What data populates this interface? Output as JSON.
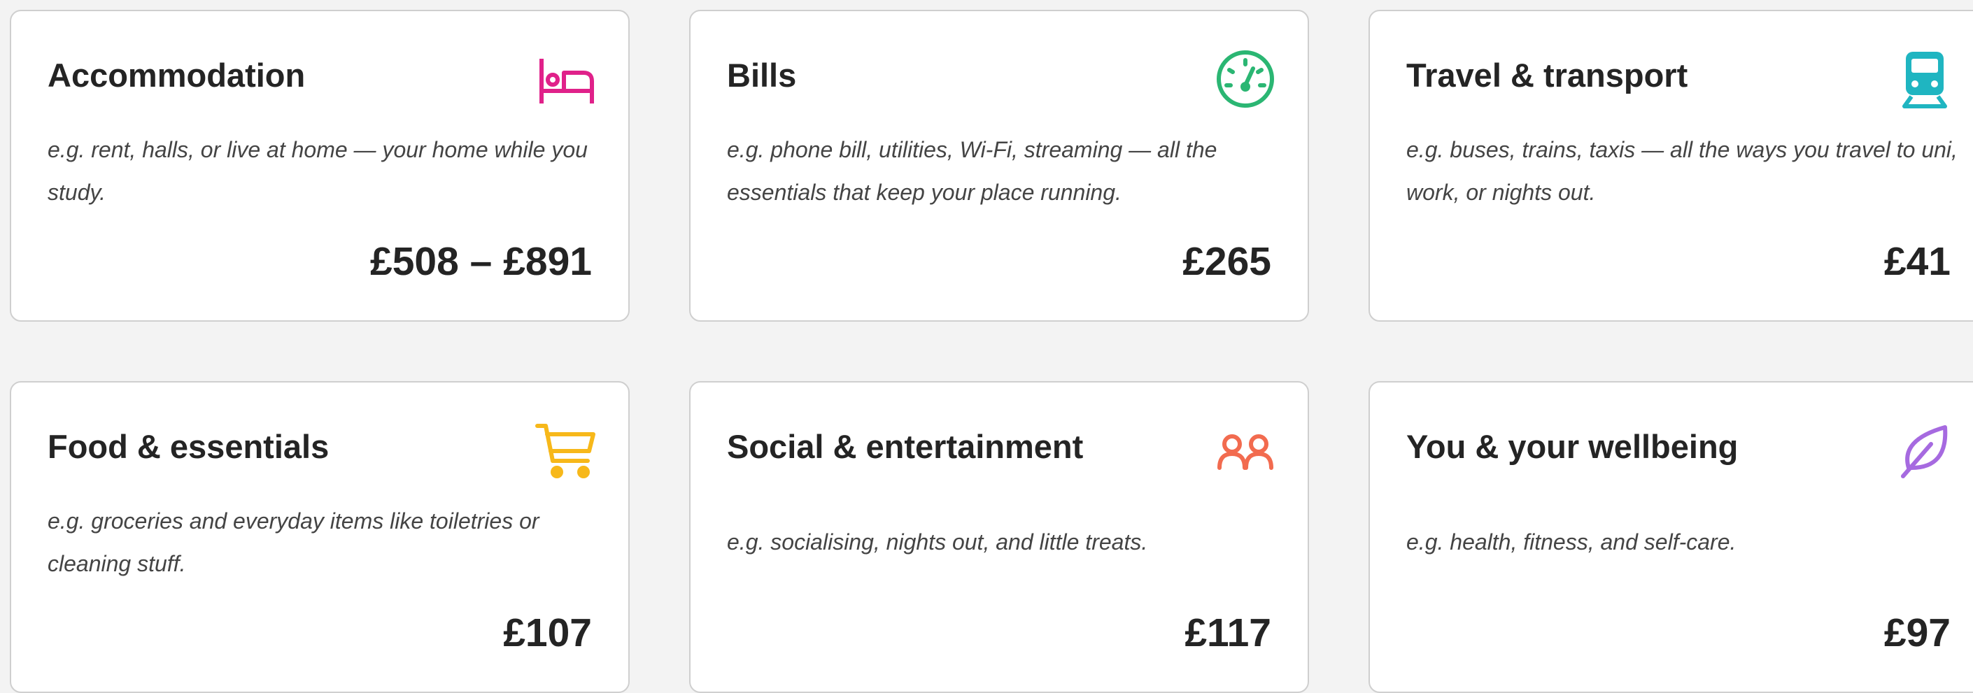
{
  "cards": [
    {
      "title": "Accommodation",
      "description": "e.g. rent, halls, or live at home — your home while you study.",
      "amount": "£508 – £891",
      "icon": "bed-icon",
      "icon_color": "#e0218a"
    },
    {
      "title": "Bills",
      "description": "e.g. phone bill, utilities, Wi-Fi, streaming — all the essentials that keep your place running.",
      "amount": "£265",
      "icon": "gauge-icon",
      "icon_color": "#2bb673"
    },
    {
      "title": "Travel & transport",
      "description": "e.g. buses, trains, taxis — all the ways you travel to uni, work, or nights out.",
      "amount": "£41",
      "icon": "train-icon",
      "icon_color": "#1fb5c1"
    },
    {
      "title": "Food & essentials",
      "description": "e.g. groceries and everyday items like toiletries or cleaning stuff.",
      "amount": "£107",
      "icon": "shopping-cart-icon",
      "icon_color": "#f7b81a"
    },
    {
      "title": "Social & entertainment",
      "description": "e.g. socialising, nights out, and little treats.",
      "amount": "£117",
      "icon": "people-icon",
      "icon_color": "#f26b4f"
    },
    {
      "title": "You & your wellbeing",
      "description": "e.g. health, fitness, and self-care.",
      "amount": "£97",
      "icon": "leaf-icon",
      "icon_color": "#a66ae0"
    }
  ]
}
